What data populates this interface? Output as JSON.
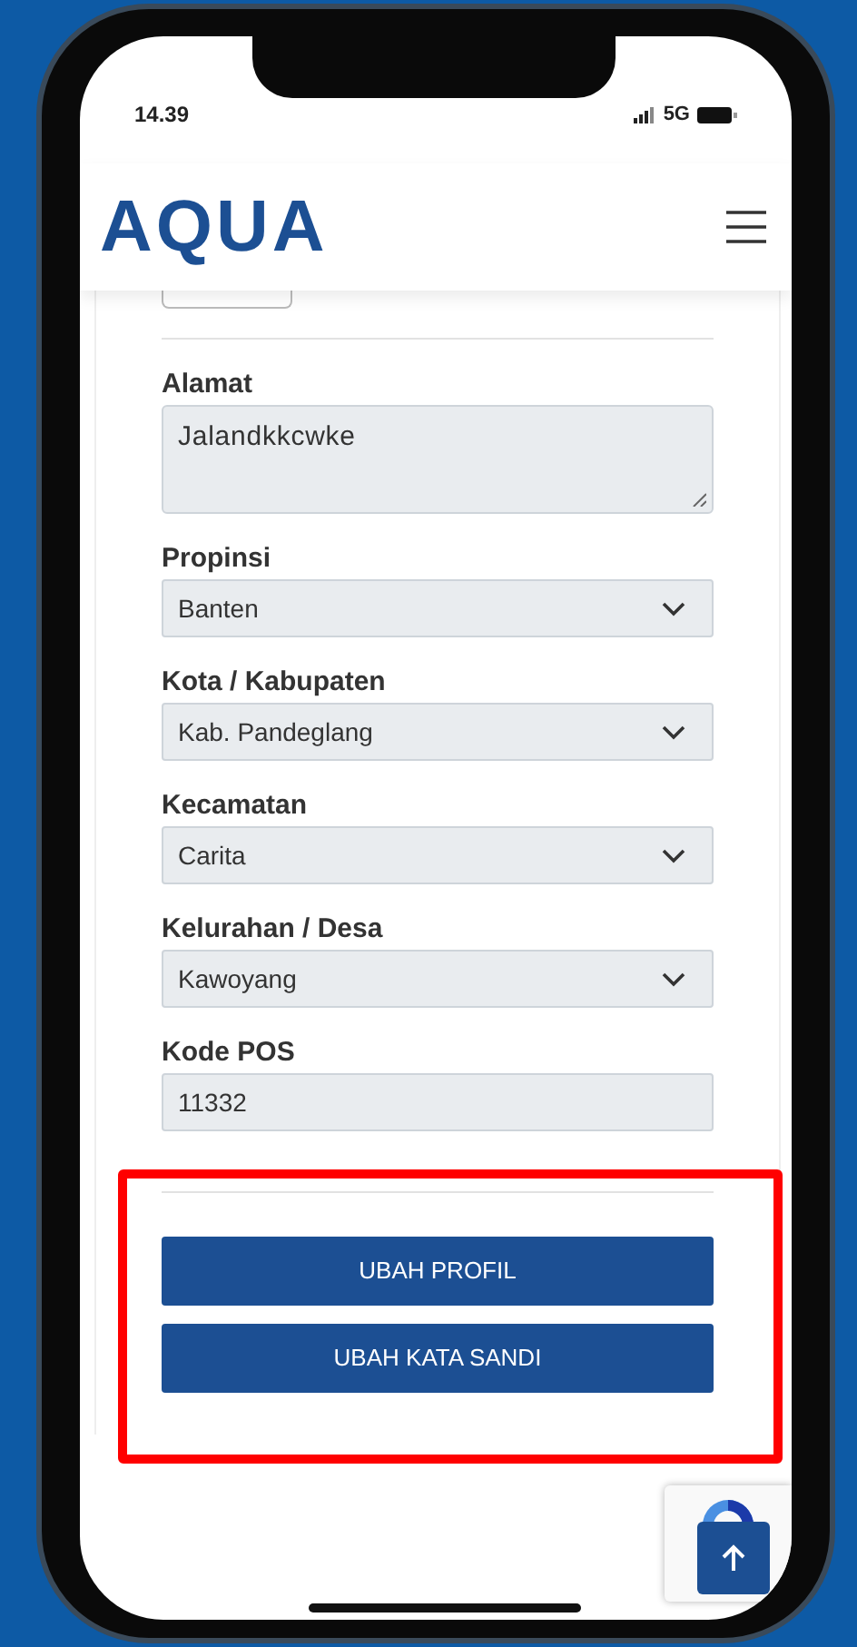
{
  "status_bar": {
    "time": "14.39",
    "network": "5G"
  },
  "header": {
    "logo": "AQUA"
  },
  "form": {
    "fields": [
      {
        "kind": "textarea",
        "label": "Alamat",
        "value": "Jalandkkcwke"
      },
      {
        "kind": "select",
        "label": "Propinsi",
        "value": "Banten"
      },
      {
        "kind": "select",
        "label": "Kota / Kabupaten",
        "value": "Kab. Pandeglang"
      },
      {
        "kind": "select",
        "label": "Kecamatan",
        "value": "Carita"
      },
      {
        "kind": "select",
        "label": "Kelurahan / Desa",
        "value": "Kawoyang"
      },
      {
        "kind": "input",
        "label": "Kode POS",
        "value": "11332"
      }
    ],
    "buttons": [
      "UBAH PROFIL",
      "UBAH KATA SANDI"
    ]
  }
}
